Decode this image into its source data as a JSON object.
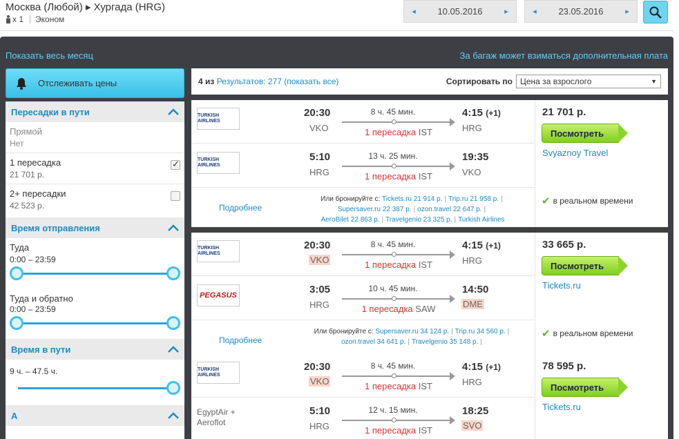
{
  "header": {
    "route": "Москва (Любой) ▸ Хургада (HRG)",
    "passengers": "x 1",
    "cabin": "Эконом",
    "date_out": "10.05.2016",
    "date_back": "23.05.2016"
  },
  "panel": {
    "show_month": "Показать весь месяц",
    "baggage_note": "За багаж может взиматься дополнительная плата",
    "track_label": "Отслеживать цены"
  },
  "filters": {
    "stops_title": "Пересадки в пути",
    "stops": [
      {
        "name": "Прямой",
        "price": "Нет",
        "checked": false,
        "disabled": true
      },
      {
        "name": "1 пересадка",
        "price": "21 701 р.",
        "checked": true,
        "disabled": false
      },
      {
        "name": "2+ пересадки",
        "price": "42 523 р.",
        "checked": false,
        "disabled": false
      }
    ],
    "departure_title": "Время отправления",
    "outbound_label": "Туда",
    "outbound_range": "0:00 – 23:59",
    "return_label": "Туда и обратно",
    "return_range": "0:00 – 23:59",
    "duration_title": "Время в пути",
    "duration_range": "9 ч. – 47.5 ч.",
    "next_title": "А"
  },
  "results": {
    "shown": "4 из",
    "count_label": "Результатов: 277",
    "show_all": "(показать все)",
    "sort_label": "Сортировать по",
    "sort_value": "Цена за взрослого"
  },
  "cards": [
    {
      "legs": [
        {
          "airline": "TURKISH AIRLINES",
          "dep_time": "20:30",
          "dep_ap": "VKO",
          "dep_hl": false,
          "duration": "8 ч. 45 мин.",
          "stops": "1 пересадка",
          "via": "IST",
          "arr_time": "4:15",
          "plus": "(+1)",
          "arr_ap": "HRG",
          "arr_hl": false
        },
        {
          "airline": "TURKISH AIRLINES",
          "dep_time": "5:10",
          "dep_ap": "HRG",
          "dep_hl": false,
          "duration": "13 ч. 25 мин.",
          "stops": "1 пересадка",
          "via": "IST",
          "arr_time": "19:35",
          "plus": "",
          "arr_ap": "VKO",
          "arr_hl": false
        }
      ],
      "details": "Подробнее",
      "alt_prefix": "Или бронируйте с:",
      "alts": [
        "Tickets.ru 21 914 р.",
        "Trip.ru 21 958 р.",
        "Supersaver.ru 22 387 р.",
        "ozon.travel 22 647 р.",
        "AeroBilet 22 863 р.",
        "Travelgenio 23 325 р.",
        "Turkish Airlines"
      ],
      "price": "21 701 р.",
      "button": "Посмотреть",
      "agent": "Svyaznoy Travel",
      "realtime": "в реальном времени"
    },
    {
      "legs": [
        {
          "airline": "TURKISH AIRLINES",
          "dep_time": "20:30",
          "dep_ap": "VKO",
          "dep_hl": true,
          "duration": "8 ч. 45 мин.",
          "stops": "1 пересадка",
          "via": "IST",
          "arr_time": "4:15",
          "plus": "(+1)",
          "arr_ap": "HRG",
          "arr_hl": false
        },
        {
          "airline": "PEGASUS",
          "dep_time": "3:05",
          "dep_ap": "HRG",
          "dep_hl": false,
          "duration": "10 ч. 45 мин.",
          "stops": "1 пересадка",
          "via": "SAW",
          "arr_time": "14:50",
          "plus": "",
          "arr_ap": "DME",
          "arr_hl": true
        }
      ],
      "details": "Подробнее",
      "alt_prefix": "Или бронируйте с:",
      "alts": [
        "Supersaver.ru 34 124 р.",
        "Trip.ru 34 560 р.",
        "ozon.travel 34 641 р.",
        "Travelgenio 35 148 р."
      ],
      "price": "33 665 р.",
      "button": "Посмотреть",
      "agent": "Tickets.ru",
      "realtime": "в реальном времени"
    },
    {
      "legs": [
        {
          "airline": "TURKISH AIRLINES",
          "dep_time": "20:30",
          "dep_ap": "VKO",
          "dep_hl": true,
          "duration": "8 ч. 45 мин.",
          "stops": "1 пересадка",
          "via": "IST",
          "arr_time": "4:15",
          "plus": "(+1)",
          "arr_ap": "HRG",
          "arr_hl": false
        },
        {
          "airline_text": "EgyptAir + Aeroflot",
          "dep_time": "5:10",
          "dep_ap": "HRG",
          "dep_hl": false,
          "duration": "12 ч. 15 мин.",
          "stops": "1 пересадка",
          "via": "IST",
          "arr_time": "18:25",
          "plus": "",
          "arr_ap": "SVO",
          "arr_hl": true
        }
      ],
      "price": "78 595 р.",
      "button": "Посмотреть",
      "agent": "Tickets.ru"
    }
  ]
}
